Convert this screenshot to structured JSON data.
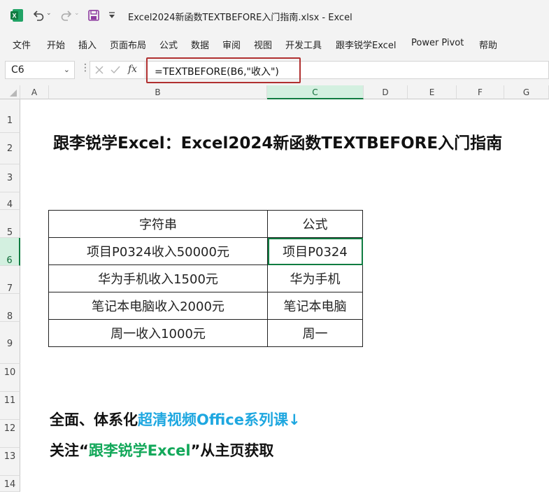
{
  "app": {
    "window_title": "Excel2024新函数TEXTBEFORE入门指南.xlsx  -  Excel",
    "icons": [
      "excel-logo-icon",
      "undo-icon",
      "redo-icon",
      "save-icon",
      "customize-qat-icon"
    ]
  },
  "menu": [
    "文件",
    "开始",
    "插入",
    "页面布局",
    "公式",
    "数据",
    "审阅",
    "视图",
    "开发工具",
    "跟李锐学Excel",
    "Power Pivot",
    "帮助"
  ],
  "formula_bar": {
    "name_box": "C6",
    "fx_label": "fx",
    "formula": "=TEXTBEFORE(B6,\"收入\")"
  },
  "columns": [
    "A",
    "B",
    "C",
    "D",
    "E",
    "F",
    "G"
  ],
  "selected_column": "C",
  "rows": [
    "1",
    "2",
    "3",
    "4",
    "5",
    "6",
    "7",
    "8",
    "9",
    "10",
    "11",
    "12",
    "13",
    "14"
  ],
  "selected_row": "6",
  "sheet": {
    "title": "跟李锐学Excel：Excel2024新函数TEXTBEFORE入门指南",
    "table": {
      "headers": [
        "字符串",
        "公式"
      ],
      "rows": [
        [
          "项目P0324收入50000元",
          "项目P0324"
        ],
        [
          "华为手机收入1500元",
          "华为手机"
        ],
        [
          "笔记本电脑收入2000元",
          "笔记本电脑"
        ],
        [
          "周一收入1000元",
          "周一"
        ]
      ]
    },
    "promo": {
      "line1_prefix": "全面、体系化",
      "line1_highlight": "超清视频Office系列课↓",
      "line2_prefix": "关注“",
      "line2_highlight": "跟李锐学Excel",
      "line2_suffix": "”从主页获取"
    }
  },
  "colors": {
    "excel_green": "#107c41",
    "highlight_red": "#b03030",
    "promo_blue": "#1ea7e0",
    "promo_green": "#13a85a"
  }
}
